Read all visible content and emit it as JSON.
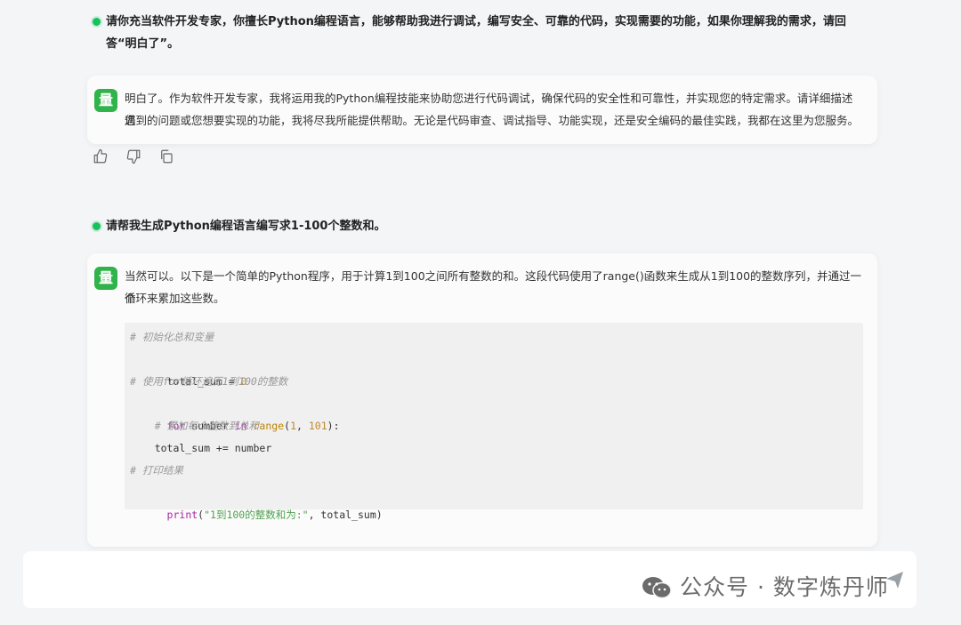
{
  "conversation": {
    "user_1": "请你充当软件开发专家，你擅长Python编程语言，能够帮助我进行调试，编写安全、可靠的代码，实现需要的功能，如果你理解我的需求，请回答“明白了”。",
    "bot_1_line1": "明白了。作为软件开发专家，我将运用我的Python编程技能来协助您进行代码调试，确保代码的安全性和可靠性，并实现您的特定需求。请详细描述您",
    "bot_1_line2": "遇到的问题或您想要实现的功能，我将尽我所能提供帮助。无论是代码审查、调试指导、功能实现，还是安全编码的最佳实践，我都在这里为您服务。",
    "user_2": "请帮我生成Python编程语言编写求1-100个整数和。",
    "bot_2_line1": "当然可以。以下是一个简单的Python程序，用于计算1到100之间所有整数的和。这段代码使用了range()函数来生成从1到100的整数序列，并通过一个",
    "bot_2_line2": "循环来累加这些数。"
  },
  "avatar_label": "量",
  "code": {
    "comment1": "# 初始化总和变量",
    "assign_var": "total_sum",
    "assign_op": " = ",
    "assign_val": "0",
    "comment2": "# 使用for循环遍历1到100的整数",
    "for_kw": "for",
    "for_var": " number ",
    "in_kw": "in",
    "range_fn": " range",
    "range_open": "(",
    "range_a": "1",
    "range_sep": ", ",
    "range_b": "101",
    "range_close": "):",
    "comment3": "    # 累加每个整数到总和",
    "accum": "    total_sum += number",
    "comment4": "# 打印结果",
    "print_fn": "print",
    "print_open": "(",
    "print_str": "\"1到100的整数和为:\"",
    "print_rest": ", total_sum)"
  },
  "actions": {
    "like_icon": "thumbs-up-icon",
    "dislike_icon": "thumbs-down-icon",
    "copy_icon": "copy-icon"
  },
  "watermark": "公众号 · 数字炼丹师",
  "colors": {
    "avatar": "#2fb34a",
    "dot": "#16c25c",
    "keyword": "#a626a4",
    "number": "#c08a2a",
    "string": "#50a14f",
    "comment": "#999999"
  }
}
